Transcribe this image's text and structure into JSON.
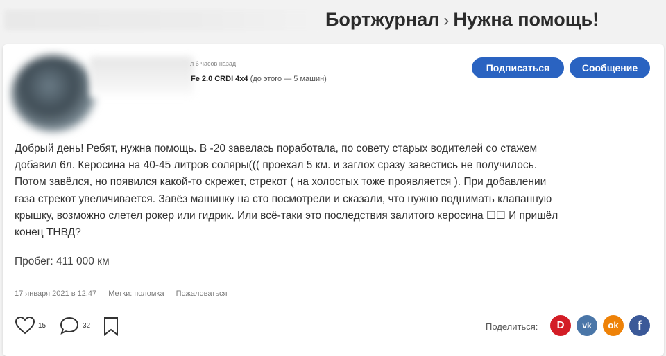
{
  "header": {
    "breadcrumb_parent": "Бортжурнал",
    "breadcrumb_sep": "›",
    "title": "Нужна помощь!"
  },
  "author": {
    "time_ago": "л 6 часов назад",
    "car_name": "Fe 2.0 CRDI 4x4",
    "car_prev": "(до этого — 5 машин)"
  },
  "buttons": {
    "subscribe": "Подписаться",
    "message": "Сообщение"
  },
  "post": {
    "text": "Добрый день! Ребят, нужна помощь. В -20 завелась поработала, по совету старых водителей со стажем добавил 6л. Керосина на 40-45 литров соляры((( проехал 5 км. и заглох сразу завестись не получилось. Потом завёлся, но появился какой-то скрежет, стрекот ( на холостых тоже проявляется ). При добавлении газа стрекот увеличивается. Завёз машинку на сто посмотрели и сказали, что нужно поднимать клапанную крышку, возможно слетел рокер или гидрик. Или всё-таки это последствия залитого керосина ☐☐ И пришёл конец ТНВД?",
    "mileage": "Пробег: 411 000 км",
    "date": "17 января 2021 в 12:47",
    "tags": "Метки: поломка",
    "report": "Пожаловаться"
  },
  "actions": {
    "likes": "15",
    "comments": "32"
  },
  "share": {
    "label": "Поделиться:",
    "drive_letter": "D",
    "vk_letter": "vk",
    "ok_letter": "ok",
    "fb_letter": "f",
    "colors": {
      "drive": "#d31d26",
      "vk": "#4a76a8",
      "ok": "#ee8208",
      "fb": "#3b5998"
    }
  },
  "colors": {
    "accent": "#2a63c1"
  }
}
